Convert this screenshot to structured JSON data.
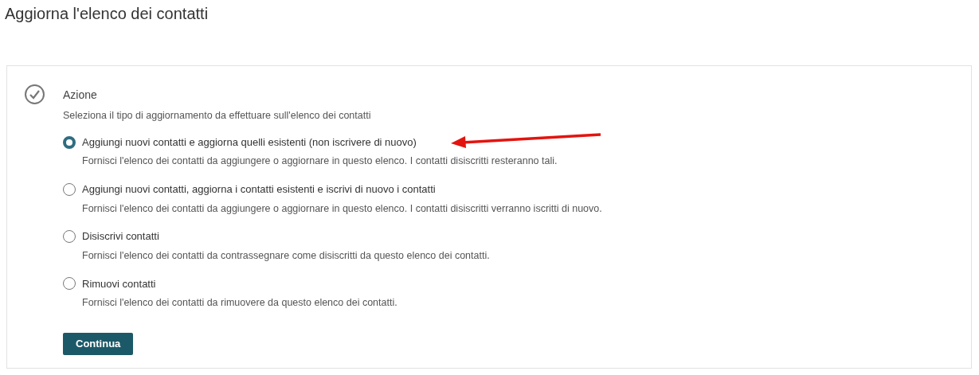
{
  "page_title": "Aggiorna l'elenco dei contatti",
  "step": {
    "title": "Azione",
    "completed": true,
    "description": "Seleziona il tipo di aggiornamento da effettuare sull'elenco dei contatti",
    "options": [
      {
        "label": "Aggiungi nuovi contatti e aggiorna quelli esistenti (non iscrivere di nuovo)",
        "description": "Fornisci l'elenco dei contatti da aggiungere o aggiornare in questo elenco. I contatti disiscritti resteranno tali.",
        "selected": true
      },
      {
        "label": "Aggiungi nuovi contatti, aggiorna i contatti esistenti e iscrivi di nuovo i contatti",
        "description": "Fornisci l'elenco dei contatti da aggiungere o aggiornare in questo elenco. I contatti disiscritti verranno iscritti di nuovo.",
        "selected": false
      },
      {
        "label": "Disiscrivi contatti",
        "description": "Fornisci l'elenco dei contatti da contrassegnare come disiscritti da questo elenco dei contatti.",
        "selected": false
      },
      {
        "label": "Rimuovi contatti",
        "description": "Fornisci l'elenco dei contatti da rimuovere da questo elenco dei contatti.",
        "selected": false
      }
    ],
    "button": "Continua"
  }
}
